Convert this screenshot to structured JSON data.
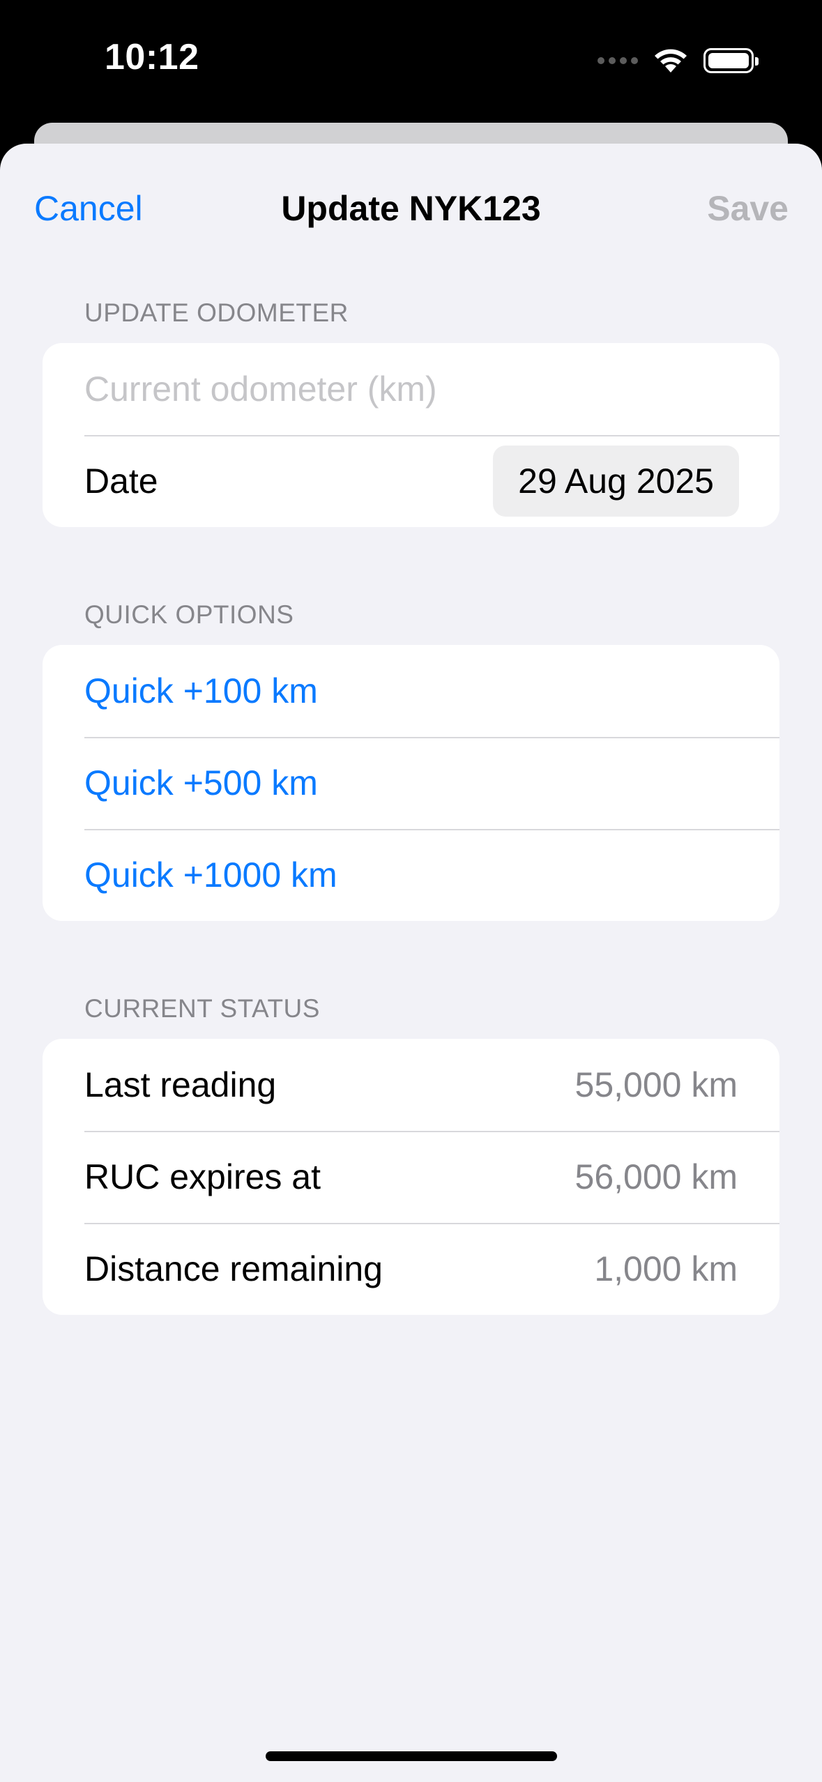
{
  "status_bar": {
    "time": "10:12",
    "icons": [
      "signal-dots-icon",
      "wifi-icon",
      "battery-icon"
    ]
  },
  "nav": {
    "cancel_label": "Cancel",
    "title": "Update NYK123",
    "save_label": "Save"
  },
  "update_odometer": {
    "header": "UPDATE ODOMETER",
    "odometer_placeholder": "Current odometer (km)",
    "odometer_value": "",
    "date_label": "Date",
    "date_value": "29 Aug 2025"
  },
  "quick_options": {
    "header": "QUICK OPTIONS",
    "items": [
      {
        "label": "Quick +100 km"
      },
      {
        "label": "Quick +500 km"
      },
      {
        "label": "Quick +1000 km"
      }
    ]
  },
  "current_status": {
    "header": "CURRENT STATUS",
    "rows": [
      {
        "label": "Last reading",
        "value": "55,000 km"
      },
      {
        "label": "RUC expires at",
        "value": "56,000 km"
      },
      {
        "label": "Distance remaining",
        "value": "1,000 km"
      }
    ]
  },
  "colors": {
    "accent": "#0a7aff",
    "background": "#f2f2f7",
    "secondary_text": "#86868b",
    "disabled_text": "#b5b5b9"
  }
}
